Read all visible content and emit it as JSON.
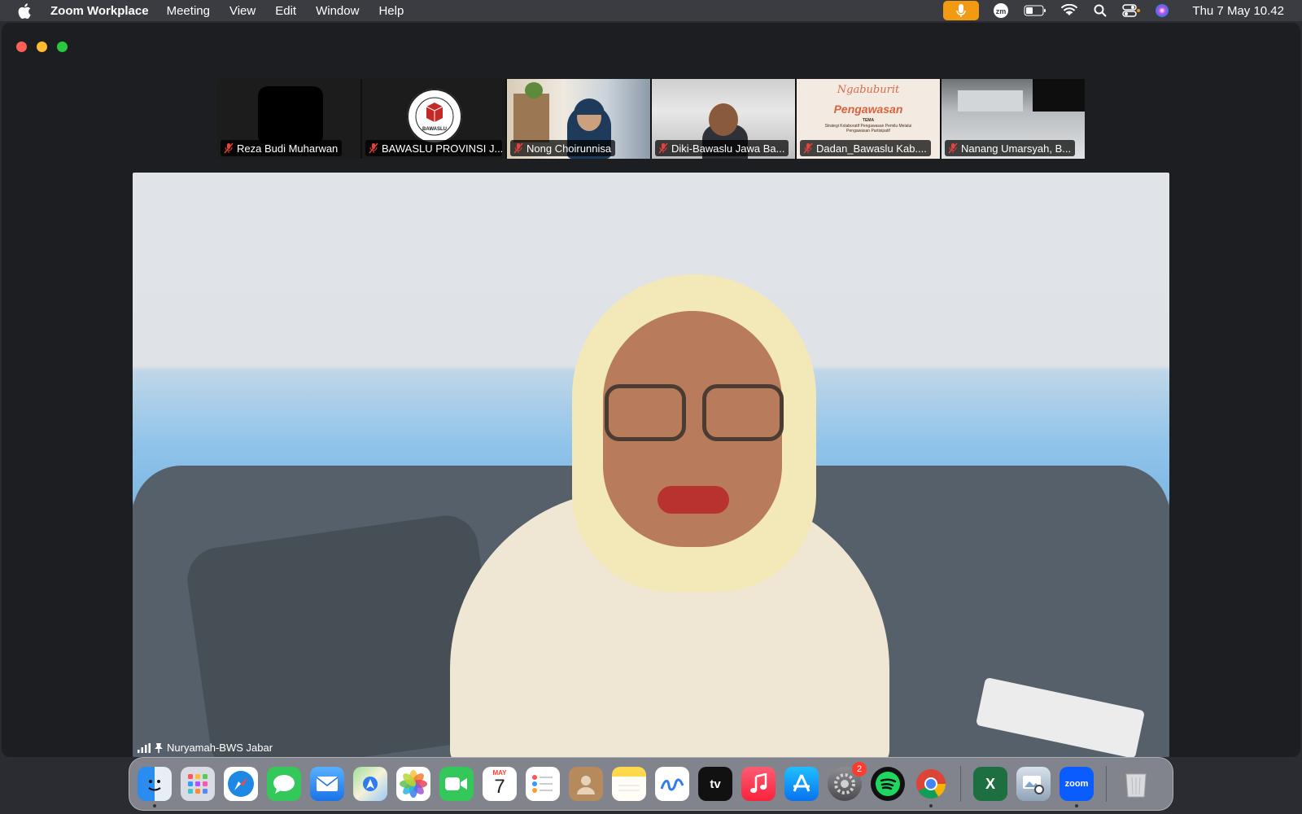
{
  "menubar": {
    "app_name": "Zoom Workplace",
    "items": [
      "Meeting",
      "View",
      "Edit",
      "Window",
      "Help"
    ],
    "clock": "Thu 7 May  10.42"
  },
  "thumbnails": [
    {
      "name": "Reza Budi Muharwan",
      "muted": true
    },
    {
      "name": "BAWASLU PROVINSI J...",
      "muted": true,
      "logo_text": "BAWASLU"
    },
    {
      "name": "Nong Choirunnisa",
      "muted": true
    },
    {
      "name": "Diki-Bawaslu Jawa Ba...",
      "muted": true
    },
    {
      "name": "Dadan_Bawaslu Kab....",
      "muted": true,
      "slide": {
        "script": "Ngabuburit",
        "title": "Pengawasan",
        "label": "TEMA",
        "subtitle": "Strategi Kolaboratif Pengawasan Pemilu Melalui Pengawasan Partisipatif"
      }
    },
    {
      "name": "Nanang Umarsyah, B...",
      "muted": true
    }
  ],
  "main_video": {
    "speaker_name": "Nuryamah-BWS Jabar"
  },
  "dock": {
    "items": [
      {
        "name": "Finder",
        "running": true
      },
      {
        "name": "Launchpad"
      },
      {
        "name": "Safari"
      },
      {
        "name": "Messages"
      },
      {
        "name": "Mail"
      },
      {
        "name": "Maps"
      },
      {
        "name": "Photos"
      },
      {
        "name": "FaceTime"
      },
      {
        "name": "Calendar",
        "month": "MAY",
        "day": "7"
      },
      {
        "name": "Reminders"
      },
      {
        "name": "Contacts"
      },
      {
        "name": "Notes"
      },
      {
        "name": "Freeform"
      },
      {
        "name": "TV",
        "label": "tv"
      },
      {
        "name": "Music"
      },
      {
        "name": "App Store"
      },
      {
        "name": "System Settings",
        "badge": "2"
      },
      {
        "name": "Spotify"
      },
      {
        "name": "Chrome",
        "running": true
      },
      {
        "name": "Excel",
        "label": "X"
      },
      {
        "name": "Preview"
      },
      {
        "name": "Zoom",
        "label": "zoom",
        "running": true
      },
      {
        "name": "Trash"
      }
    ]
  },
  "colors": {
    "accent_mic": "#f29a12",
    "muted_red": "#e8413b",
    "window_bg": "#1c1e22"
  }
}
